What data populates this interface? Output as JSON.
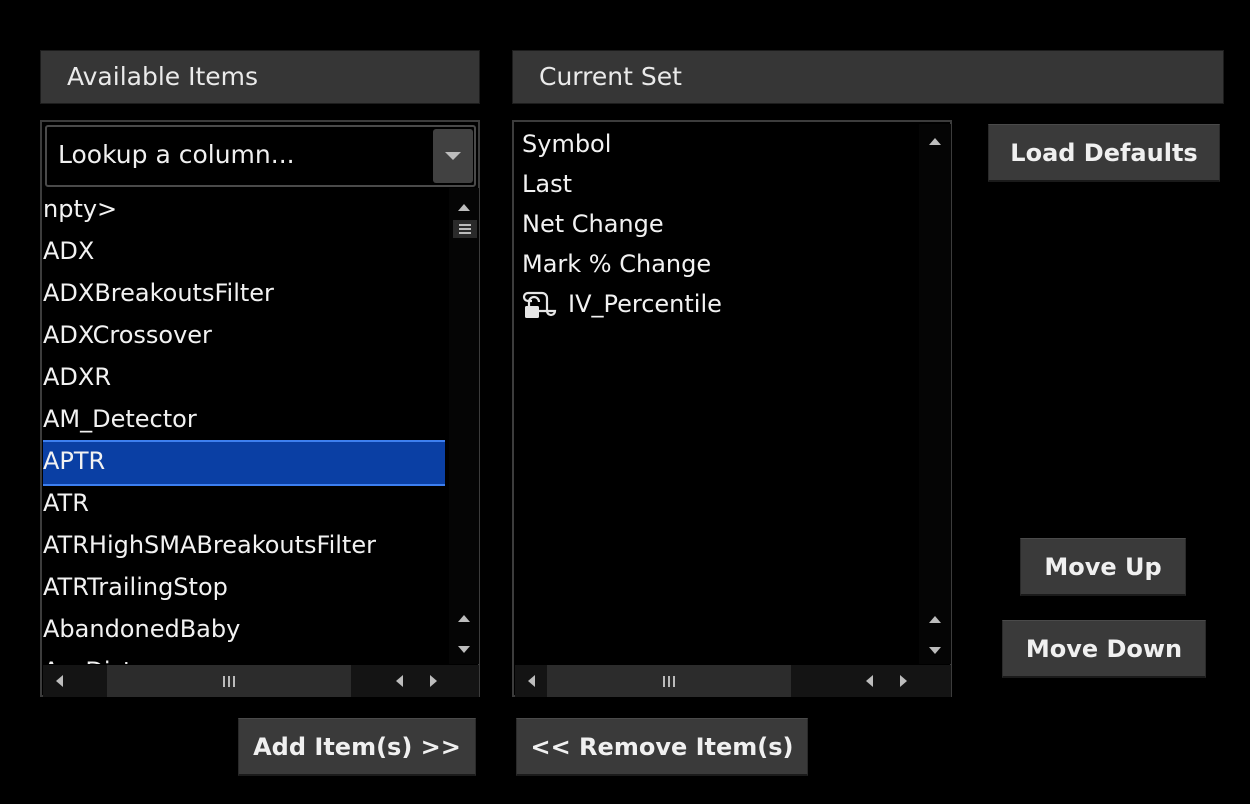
{
  "available": {
    "header": "Available Items",
    "lookup_placeholder": "Lookup a column...",
    "items": [
      {
        "label": "npty>",
        "selected": false
      },
      {
        "label": "ADX",
        "selected": false
      },
      {
        "label": "ADXBreakoutsFilter",
        "selected": false
      },
      {
        "label": "ADXCrossover",
        "selected": false
      },
      {
        "label": "ADXR",
        "selected": false
      },
      {
        "label": "AM_Detector",
        "selected": false
      },
      {
        "label": "APTR",
        "selected": true
      },
      {
        "label": "ATR",
        "selected": false
      },
      {
        "label": "ATRHighSMABreakoutsFilter",
        "selected": false
      },
      {
        "label": "ATRTrailingStop",
        "selected": false
      },
      {
        "label": "AbandonedBaby",
        "selected": false
      },
      {
        "label": "AccDist",
        "selected": false
      }
    ]
  },
  "current_set": {
    "header": "Current Set",
    "items": [
      {
        "label": "Symbol",
        "icon": ""
      },
      {
        "label": "Last",
        "icon": ""
      },
      {
        "label": "Net Change",
        "icon": ""
      },
      {
        "label": "Mark % Change",
        "icon": ""
      },
      {
        "label": "IV_Percentile",
        "icon": "lock-script-icon"
      }
    ]
  },
  "buttons": {
    "load_defaults": "Load Defaults",
    "move_up": "Move Up",
    "move_down": "Move Down",
    "add_items": "Add Item(s) >>",
    "remove_items": "<< Remove Item(s)"
  },
  "colors": {
    "background": "#000000",
    "header_bg": "#363636",
    "selection": "#0a3fa4",
    "button_bg": "#3a3a3a"
  }
}
